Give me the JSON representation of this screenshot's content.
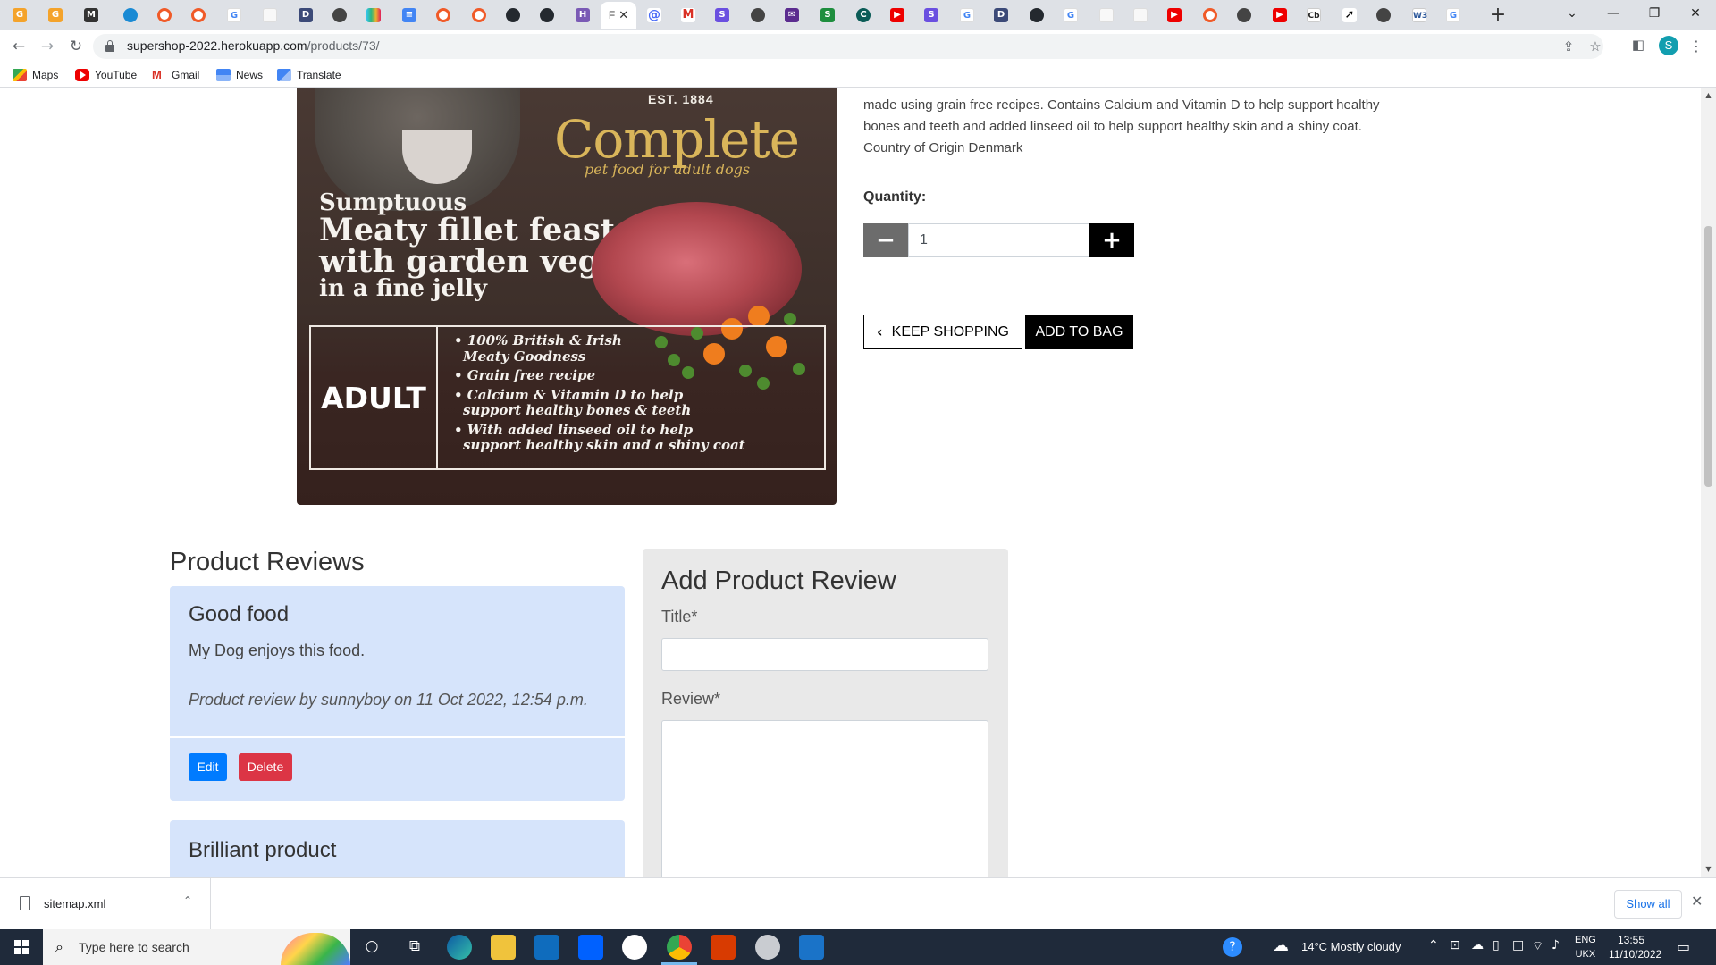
{
  "browser": {
    "active_tab_title": "F",
    "url_host": "supershop-2022.herokuapp.com",
    "url_path": "/products/73/",
    "profile_initial": "S",
    "bookmarks": [
      {
        "label": "Maps",
        "icon": "maps-icon"
      },
      {
        "label": "YouTube",
        "icon": "youtube-icon"
      },
      {
        "label": "Gmail",
        "icon": "gmail-icon"
      },
      {
        "label": "News",
        "icon": "news-icon"
      },
      {
        "label": "Translate",
        "icon": "translate-icon"
      }
    ]
  },
  "product": {
    "image_text": {
      "est": "EST. 1884",
      "brand": "Complete",
      "tagline": "pet food for adult dogs",
      "headline_1": "Sumptuous",
      "headline_2": "Meaty fillet feast",
      "headline_3": "with garden veg",
      "headline_4": "in a fine jelly",
      "badge": "ADULT",
      "bullets": [
        "• 100% British & Irish",
        "  Meaty Goodness",
        "• Grain free recipe",
        "• Calcium & Vitamin D to help",
        "  support healthy bones & teeth",
        "• With added linseed oil to help",
        "  support healthy skin and a shiny coat"
      ]
    },
    "description_1": "made using grain free recipes. Contains Calcium and Vitamin D to help support healthy",
    "description_2": "bones and teeth and added linseed oil to help support healthy skin and a shiny coat.",
    "description_3": "Country of Origin Denmark",
    "quantity_label": "Quantity:",
    "quantity_value": "1",
    "keep_shopping_label": "KEEP SHOPPING",
    "add_to_bag_label": "ADD TO BAG"
  },
  "reviews": {
    "heading": "Product Reviews",
    "items": [
      {
        "title": "Good food",
        "body": "My Dog enjoys this food.",
        "meta": "Product review by sunnyboy on 11 Oct 2022, 12:54 p.m.",
        "edit_label": "Edit",
        "delete_label": "Delete"
      },
      {
        "title": "Brilliant product"
      }
    ]
  },
  "add_review": {
    "heading": "Add Product Review",
    "title_label": "Title*",
    "review_label": "Review*"
  },
  "downloads": {
    "file_name": "sitemap.xml",
    "show_all_label": "Show all"
  },
  "taskbar": {
    "search_placeholder": "Type here to search",
    "weather": "14°C  Mostly cloudy",
    "lang_1": "ENG",
    "lang_2": "UKX",
    "time": "13:55",
    "date": "11/10/2022"
  },
  "colors": {
    "review_card_bg": "#d6e4fb",
    "add_review_bg": "#e9e9e9",
    "edit_button": "#007bff",
    "delete_button": "#dc3545",
    "brand_gold": "#d9b55a"
  }
}
